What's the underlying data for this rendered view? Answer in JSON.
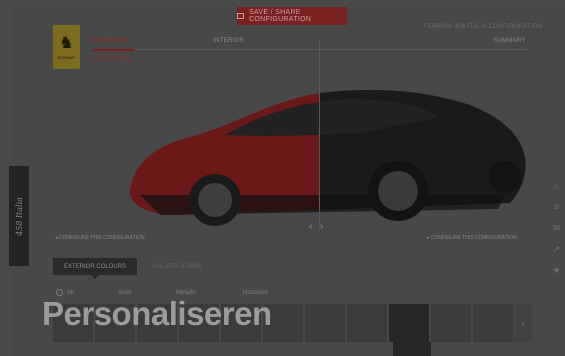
{
  "header": {
    "top_button_label": "SAVE / SHARE CONFIGURATION",
    "config_name": "FERRARI 458 ITALIA CONFIGURATION",
    "steps": {
      "exterior": "EXTERIOR",
      "interior": "INTERIOR",
      "summary": "SUMMARY",
      "sub": "PAINTWORK"
    }
  },
  "logo": {
    "text": "FERRARI"
  },
  "car": {
    "colors": {
      "left": "#6a1818",
      "right": "#1a1a1a",
      "body_shadow": "#111111"
    }
  },
  "compare": {
    "arrows": "‹ ›",
    "left_label": "◂ CONFIGURE THIS CONFIGURATION",
    "right_label": "▸ CONFIGURE THIS CONFIGURATION"
  },
  "tabs": {
    "active": "EXTERIOR COLOURS",
    "inactive": "CALIPER & RIMS"
  },
  "filters": {
    "all": "All",
    "solid": "Solid",
    "metallic": "Metallic",
    "historical": "Historical"
  },
  "swatches": {
    "count": 11,
    "selected_index": 8,
    "next_icon": "›"
  },
  "overlay": {
    "title": "Personaliseren"
  },
  "side_badge": {
    "text": "458 Italia"
  },
  "right_icons": [
    "⌂",
    "≡",
    "✉",
    "↗",
    "★"
  ]
}
